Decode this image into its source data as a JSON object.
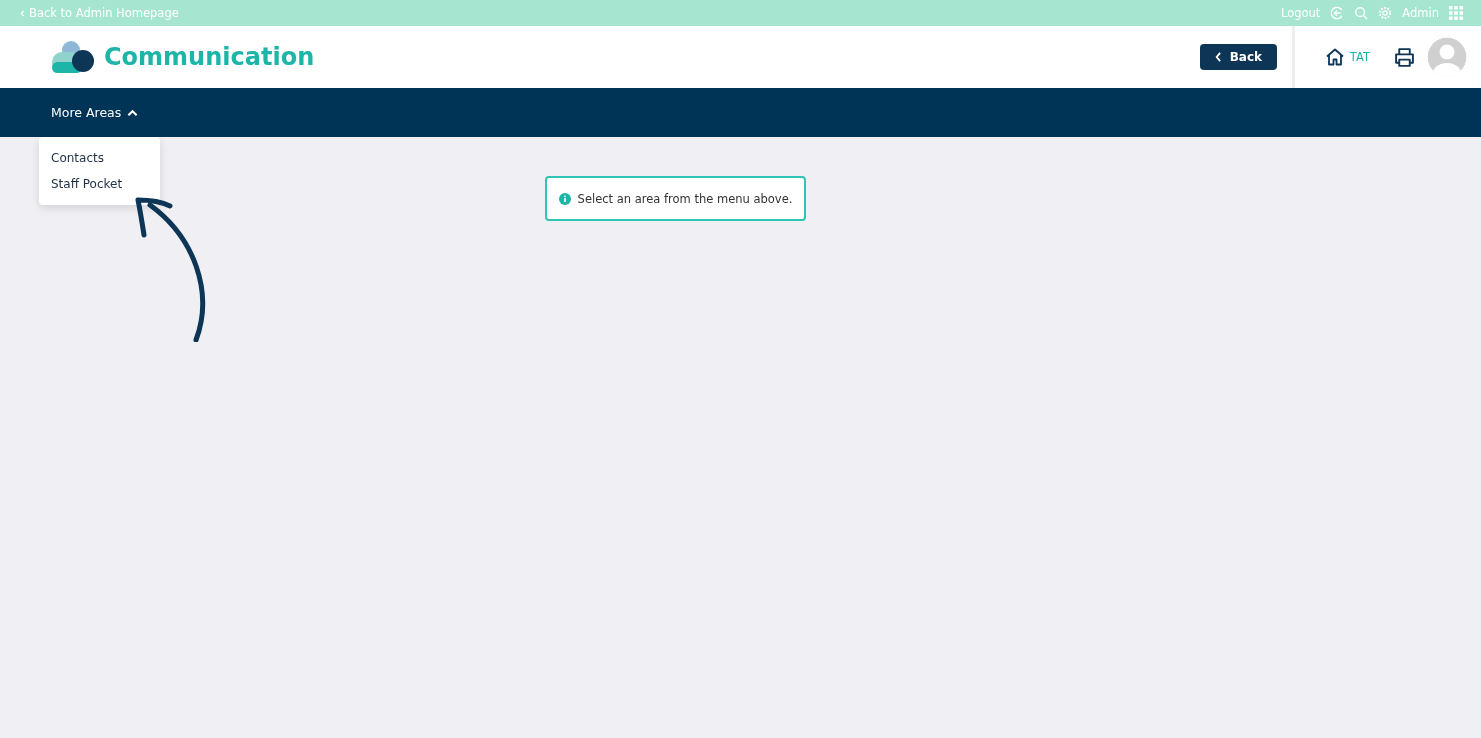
{
  "top_bar": {
    "back_link": "Back to Admin Homepage",
    "logout": "Logout",
    "user": "Admin"
  },
  "header": {
    "title": "Communication",
    "back_button": "Back",
    "home_label": "TAT"
  },
  "nav": {
    "menu": {
      "label": "More Areas",
      "expanded": true,
      "items": [
        {
          "label": "Contacts"
        },
        {
          "label": "Staff Pocket"
        }
      ]
    }
  },
  "notice": {
    "text": "Select an area from the menu above."
  }
}
